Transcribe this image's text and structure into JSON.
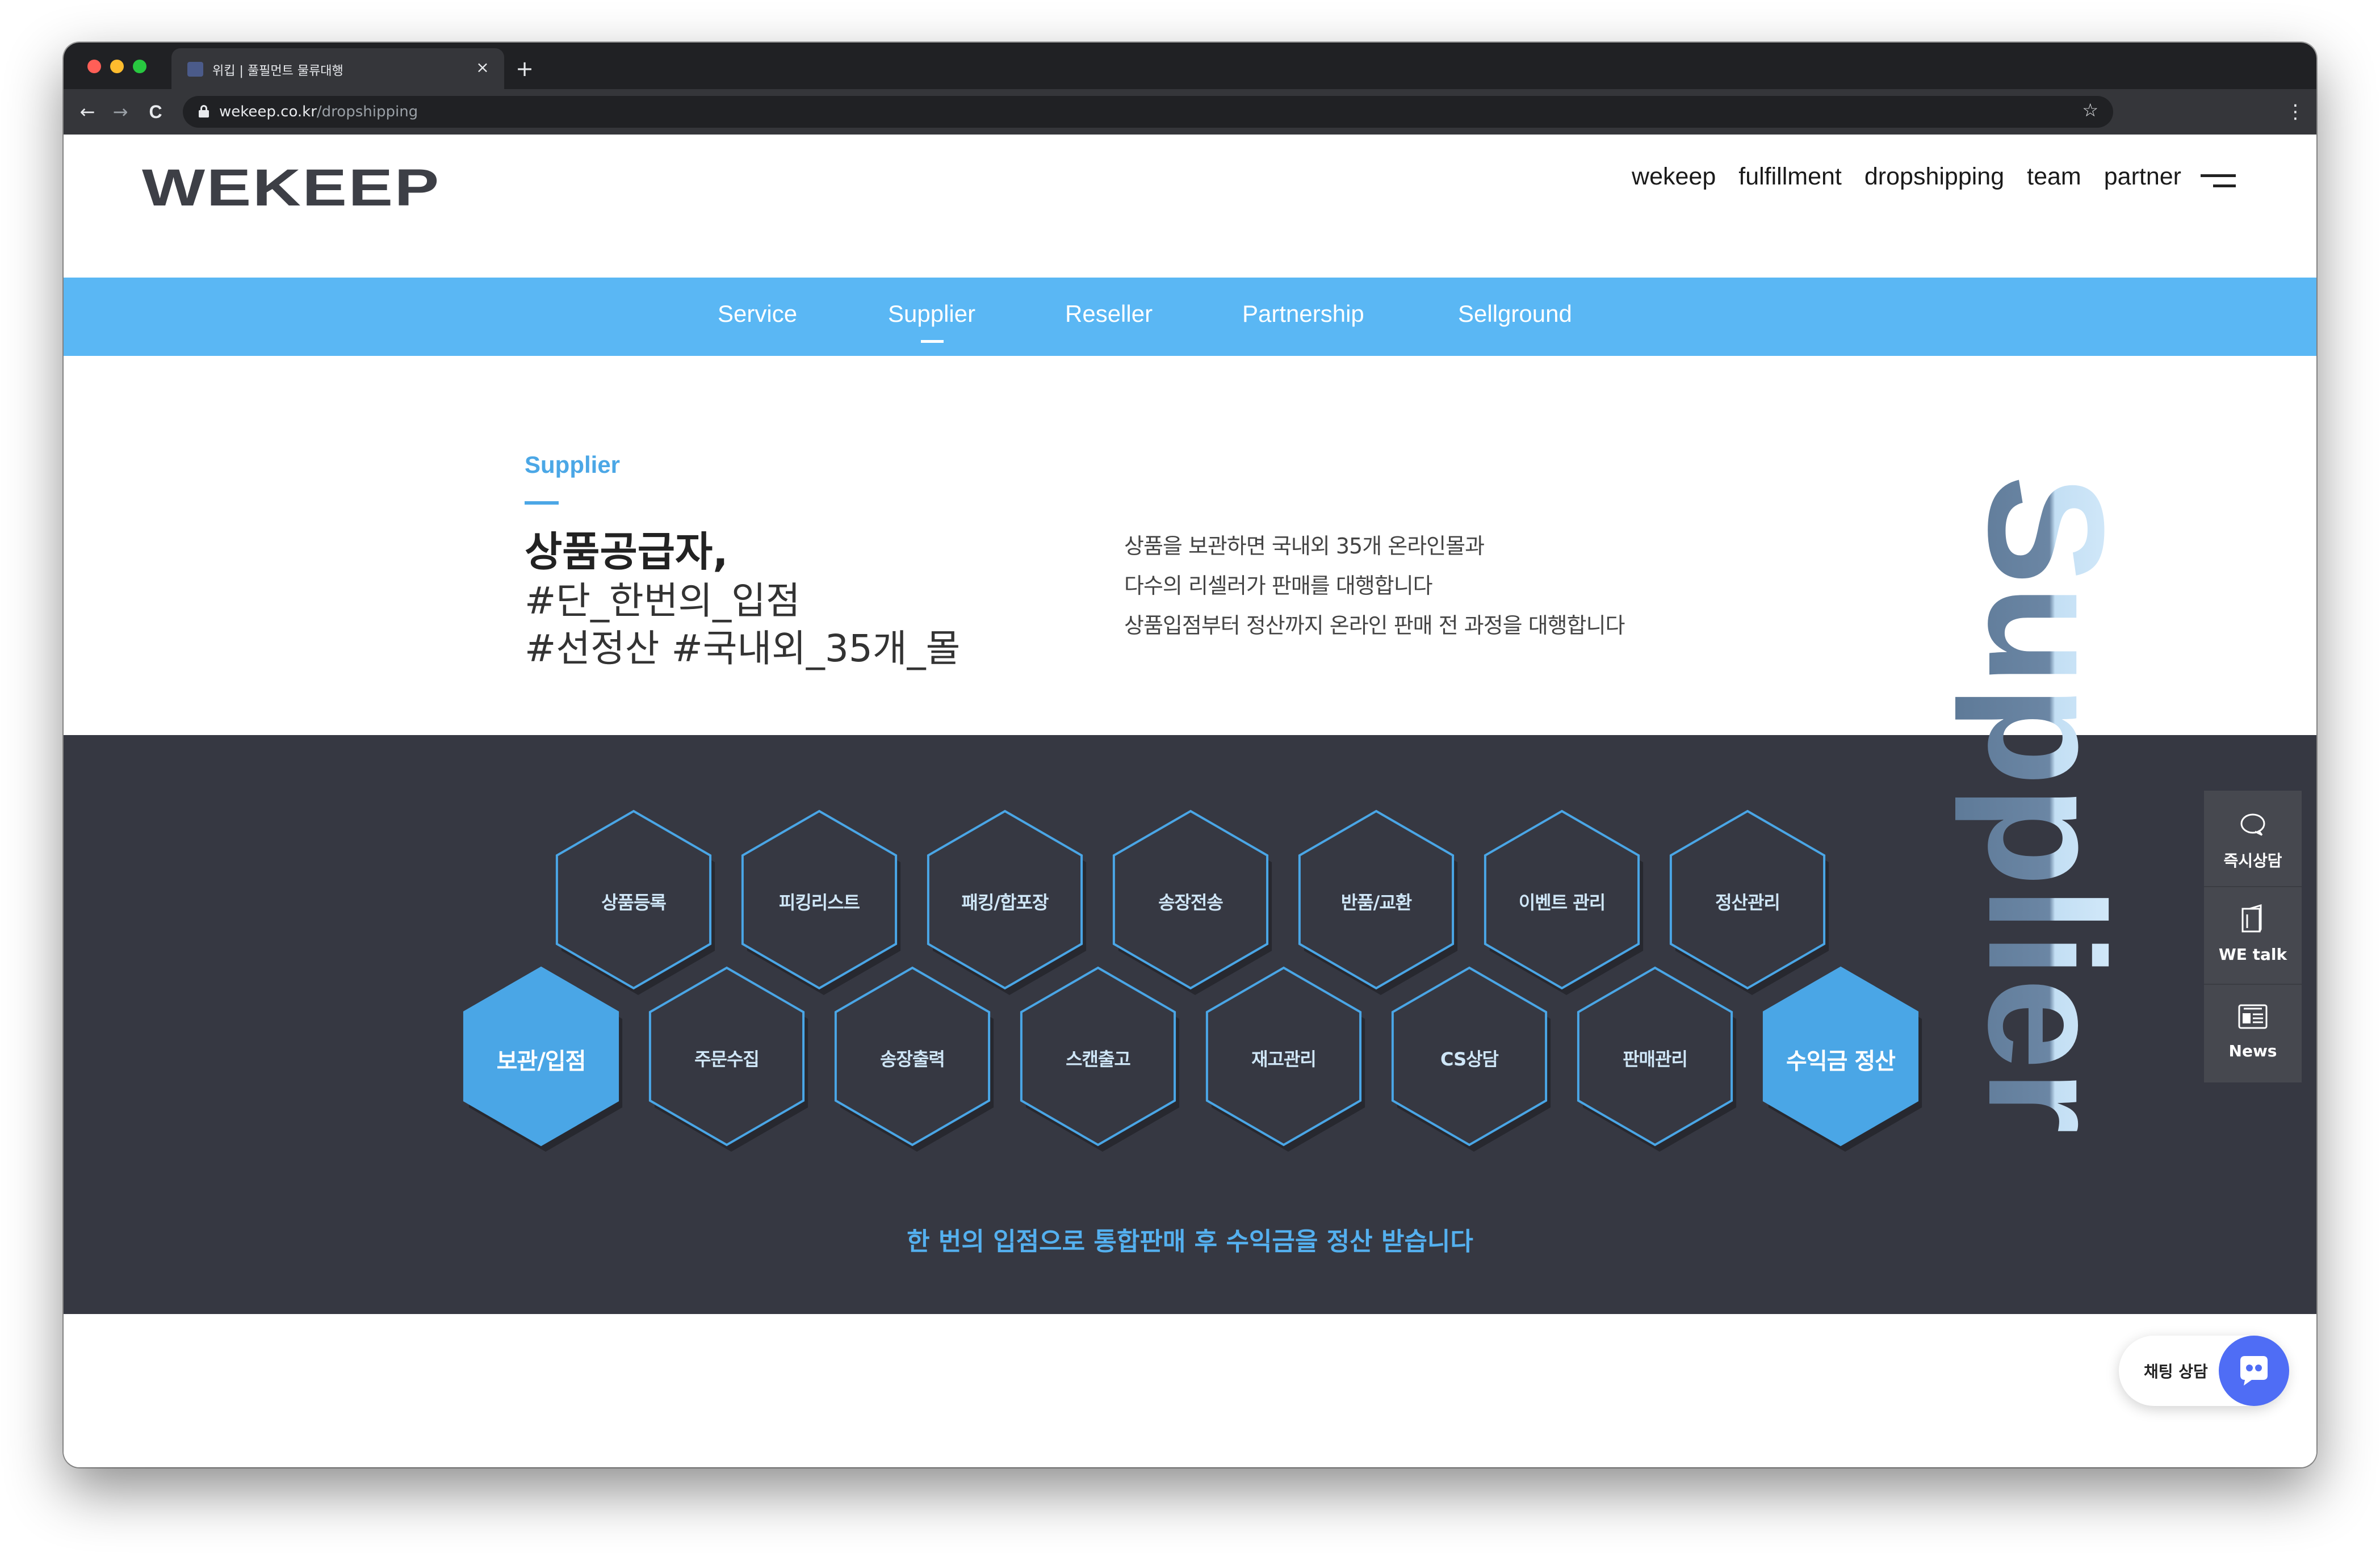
{
  "browser": {
    "tab_title": "위킵 | 풀필먼트 물류대행",
    "tab_close": "×",
    "new_tab": "+",
    "url_domain": "wekeep.co.kr",
    "url_path": "/dropshipping",
    "back": "←",
    "forward": "→",
    "reload": "C",
    "star": "☆",
    "menu": "⋮"
  },
  "header": {
    "logo": "WEKEEP",
    "nav": [
      "wekeep",
      "fulfillment",
      "dropshipping",
      "team",
      "partner"
    ]
  },
  "subnav": {
    "items": [
      "Service",
      "Supplier",
      "Reseller",
      "Partnership",
      "Sellground"
    ],
    "active": "Supplier"
  },
  "intro": {
    "eyebrow": "Supplier",
    "headline_1": "상품공급자,",
    "headline_2": "#단_한번의_입점",
    "headline_3": "#선정산 #국내외_35개_몰",
    "desc": [
      "상품을 보관하면 국내외 35개 온라인몰과",
      "다수의 리셀러가 판매를 대행합니다",
      "상품입점부터 정산까지 온라인 판매 전 과정을 대행합니다"
    ],
    "vertical_word": "Supplier"
  },
  "process": {
    "top_row": [
      "상품등록",
      "피킹리스트",
      "패킹/합포장",
      "송장전송",
      "반품/교환",
      "이벤트 관리",
      "정산관리"
    ],
    "bottom_row": [
      "보관/입점",
      "주문수집",
      "송장출력",
      "스캔출고",
      "재고관리",
      "CS상담",
      "판매관리",
      "수익금 정산"
    ],
    "tagline": "한 번의 입점으로 통합판매 후 수익금을 정산 받습니다",
    "colors": {
      "outline": "#4aa6e6",
      "filled": "#4aa6e6",
      "bg": "#363842"
    }
  },
  "sidepanel": {
    "items": [
      {
        "label": "즉시상담",
        "icon": "chat-bubble-icon"
      },
      {
        "label": "WE talk",
        "icon": "book-icon"
      },
      {
        "label": "News",
        "icon": "newspaper-icon"
      }
    ]
  },
  "chat": {
    "label": "채팅 상담"
  }
}
